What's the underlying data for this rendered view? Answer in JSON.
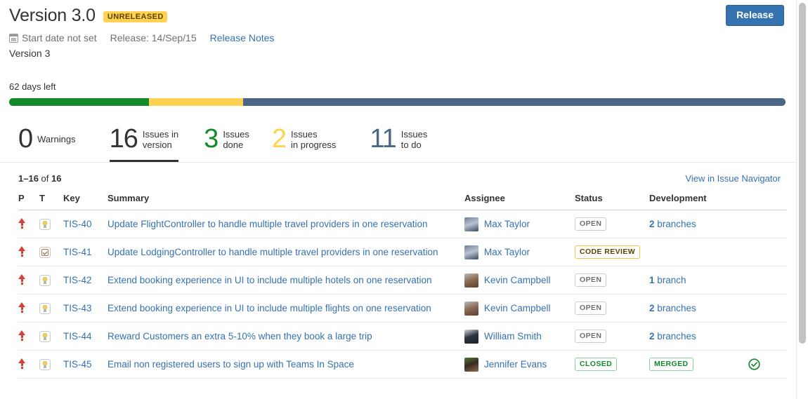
{
  "header": {
    "title": "Version 3.0",
    "status_lozenge": "UNRELEASED",
    "start_date": "Start date not set",
    "release_date": "Release: 14/Sep/15",
    "release_notes_link": "Release Notes",
    "description": "Version 3",
    "release_button": "Release",
    "calendar_icon": "calendar-icon"
  },
  "progress": {
    "days_left": "62 days left",
    "segments": [
      {
        "name": "done",
        "color": "#14892c",
        "percent": 18.0
      },
      {
        "name": "in-progress",
        "color": "#ffd351",
        "percent": 12.1
      },
      {
        "name": "to-do",
        "color": "#4a6785",
        "percent": 69.9
      }
    ]
  },
  "stats": [
    {
      "number": "0",
      "label": "Warnings",
      "color": "#333333",
      "active": false
    },
    {
      "number": "16",
      "label": "Issues in\nversion",
      "color": "#333333",
      "active": true
    },
    {
      "number": "3",
      "label": "Issues\ndone",
      "color": "#14892c",
      "active": false
    },
    {
      "number": "2",
      "label": "Issues\nin progress",
      "color": "#ffd351",
      "active": false
    },
    {
      "number": "11",
      "label": "Issues\nto do",
      "color": "#4a6785",
      "active": false
    }
  ],
  "table": {
    "count_prefix": "1–16",
    "count_middle": " of ",
    "count_total": "16",
    "navigator_link": "View in Issue Navigator",
    "columns": {
      "priority": "P",
      "type": "T",
      "key": "Key",
      "summary": "Summary",
      "assignee": "Assignee",
      "status": "Status",
      "development": "Development"
    },
    "rows": [
      {
        "priority_icon": "priority-major-icon",
        "type_icon": "improvement-icon",
        "type_class": "improvement",
        "key": "TIS-40",
        "summary": "Update FlightController to handle multiple travel providers in one reservation",
        "assignee": "Max Taylor",
        "avatar_colors": [
          "#6e7f96",
          "#b9c4d2",
          "#3b4a60"
        ],
        "status": "OPEN",
        "status_class": "st-open",
        "dev_count": "2",
        "dev_text": " branches",
        "merged": "",
        "check": false
      },
      {
        "priority_icon": "priority-major-icon",
        "type_icon": "task-icon",
        "type_class": "task",
        "key": "TIS-41",
        "summary": "Update LodgingController to handle multiple travel providers in one reservation",
        "assignee": "Max Taylor",
        "avatar_colors": [
          "#6e7f96",
          "#b9c4d2",
          "#3b4a60"
        ],
        "status": "CODE REVIEW",
        "status_class": "st-review",
        "dev_count": "",
        "dev_text": "",
        "merged": "",
        "check": false
      },
      {
        "priority_icon": "priority-major-icon",
        "type_icon": "improvement-icon",
        "type_class": "improvement",
        "key": "TIS-42",
        "summary": "Extend booking experience in UI to include multiple hotels on one reservation",
        "assignee": "Kevin Campbell",
        "avatar_colors": [
          "#bdbdbd",
          "#8a6a52",
          "#56402f"
        ],
        "status": "OPEN",
        "status_class": "st-open",
        "dev_count": "1",
        "dev_text": " branch",
        "merged": "",
        "check": false
      },
      {
        "priority_icon": "priority-major-icon",
        "type_icon": "improvement-icon",
        "type_class": "improvement",
        "key": "TIS-43",
        "summary": "Extend booking experience in UI to include multiple flights on one reservation",
        "assignee": "Kevin Campbell",
        "avatar_colors": [
          "#bdbdbd",
          "#8a6a52",
          "#56402f"
        ],
        "status": "OPEN",
        "status_class": "st-open",
        "dev_count": "2",
        "dev_text": " branches",
        "merged": "",
        "check": false
      },
      {
        "priority_icon": "priority-major-icon",
        "type_icon": "improvement-icon",
        "type_class": "improvement",
        "key": "TIS-44",
        "summary": "Reward Customers an extra 5-10% when they book a large trip",
        "assignee": "William Smith",
        "avatar_colors": [
          "#d9d9d9",
          "#2c3340",
          "#1d2128"
        ],
        "status": "OPEN",
        "status_class": "st-open",
        "dev_count": "2",
        "dev_text": " branches",
        "merged": "",
        "check": false
      },
      {
        "priority_icon": "priority-major-icon",
        "type_icon": "improvement-icon",
        "type_class": "improvement",
        "key": "TIS-45",
        "summary": "Email non registered users to sign up with Teams In Space",
        "assignee": "Jennifer Evans",
        "avatar_colors": [
          "#4f7a3a",
          "#3a2a22",
          "#8c6a52"
        ],
        "status": "CLOSED",
        "status_class": "st-closed",
        "dev_count": "",
        "dev_text": "",
        "merged": "MERGED",
        "check": true
      }
    ]
  }
}
